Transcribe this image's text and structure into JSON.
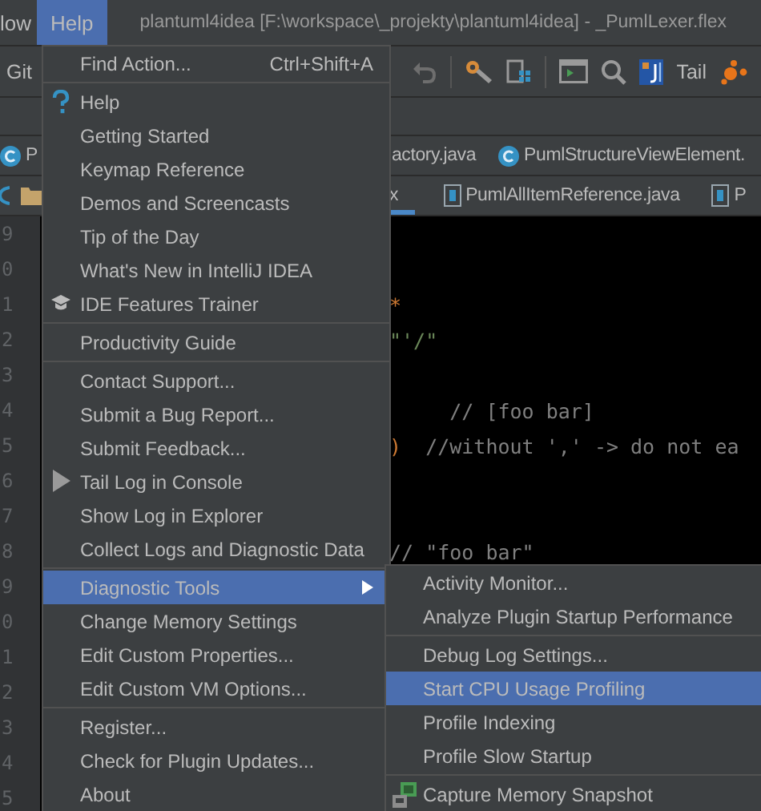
{
  "menu_bar": {
    "items": [
      {
        "label": "low",
        "selected": false
      },
      {
        "label": "Help",
        "selected": true
      }
    ],
    "title": "plantuml4idea [F:\\workspace\\_projekty\\plantuml4idea] - _PumlLexer.flex"
  },
  "toolbar": {
    "git_label": "Git",
    "tail_label": "Tail"
  },
  "tabs_row_1": [
    {
      "label": "P",
      "selected": false
    },
    {
      "label": "actory.java",
      "selected": false
    },
    {
      "label": "PumlStructureViewElement.",
      "selected": false
    }
  ],
  "tabs_row_2": [
    {
      "label": "x",
      "selected": true
    },
    {
      "label": "PumlAllItemReference.java",
      "selected": false
    },
    {
      "label": "P",
      "selected": false
    }
  ],
  "editor": {
    "lines": [
      {
        "number": "9"
      },
      {
        "number": "0"
      },
      {
        "number": "1",
        "code": [
          {
            "text": "*",
            "kind": "keyword"
          }
        ]
      },
      {
        "number": "2",
        "code": [
          {
            "text": "\"'/\"",
            "kind": "string"
          }
        ]
      },
      {
        "number": "3"
      },
      {
        "number": "4",
        "code": [
          {
            "text": "     // [foo bar]",
            "kind": "comment"
          }
        ]
      },
      {
        "number": "5",
        "code": [
          {
            "text": ")",
            "kind": "keyword"
          },
          {
            "text": "  //without ',' -> do not ea",
            "kind": "comment"
          }
        ]
      },
      {
        "number": "6"
      },
      {
        "number": "7"
      },
      {
        "number": "8",
        "code": [
          {
            "text": "// \"foo bar\"",
            "kind": "comment"
          }
        ]
      },
      {
        "number": "9"
      },
      {
        "number": "0"
      },
      {
        "number": "1"
      },
      {
        "number": "2"
      },
      {
        "number": "3"
      },
      {
        "number": "4"
      },
      {
        "number": "5"
      }
    ]
  },
  "help_menu": {
    "groups": [
      [
        {
          "label": "Find Action...",
          "shortcut": "Ctrl+Shift+A",
          "kind": "plain",
          "selected": false
        }
      ],
      [
        {
          "label": "Help",
          "kind": "help",
          "selected": false
        },
        {
          "label": "Getting Started",
          "kind": "plain",
          "selected": false
        },
        {
          "label": "Keymap Reference",
          "kind": "plain",
          "selected": false
        },
        {
          "label": "Demos and Screencasts",
          "kind": "plain",
          "selected": false
        },
        {
          "label": "Tip of the Day",
          "kind": "plain",
          "selected": false
        },
        {
          "label": "What's New in IntelliJ IDEA",
          "kind": "plain",
          "selected": false
        },
        {
          "label": "IDE Features Trainer",
          "kind": "trainer",
          "selected": false
        }
      ],
      [
        {
          "label": "Productivity Guide",
          "kind": "plain",
          "selected": false
        }
      ],
      [
        {
          "label": "Contact Support...",
          "kind": "plain",
          "selected": false
        },
        {
          "label": "Submit a Bug Report...",
          "kind": "plain",
          "selected": false
        },
        {
          "label": "Submit Feedback...",
          "kind": "plain",
          "selected": false
        },
        {
          "label": "Tail Log in Console",
          "kind": "console",
          "selected": false
        },
        {
          "label": "Show Log in Explorer",
          "kind": "plain",
          "selected": false
        },
        {
          "label": "Collect Logs and Diagnostic Data",
          "kind": "plain",
          "selected": false
        }
      ],
      [
        {
          "label": "Diagnostic Tools",
          "kind": "submenu",
          "selected": true
        },
        {
          "label": "Change Memory Settings",
          "kind": "plain",
          "selected": false
        },
        {
          "label": "Edit Custom Properties...",
          "kind": "plain",
          "selected": false
        },
        {
          "label": "Edit Custom VM Options...",
          "kind": "plain",
          "selected": false
        }
      ],
      [
        {
          "label": "Register...",
          "kind": "plain",
          "selected": false
        },
        {
          "label": "Check for Plugin Updates...",
          "kind": "plain",
          "selected": false
        },
        {
          "label": "About",
          "kind": "plain",
          "selected": false
        }
      ]
    ]
  },
  "diagnostic_submenu": {
    "groups": [
      [
        {
          "label": "Activity Monitor...",
          "kind": "plain",
          "selected": false
        },
        {
          "label": "Analyze Plugin Startup Performance",
          "kind": "plain",
          "selected": false
        }
      ],
      [
        {
          "label": "Debug Log Settings...",
          "kind": "plain",
          "selected": false
        },
        {
          "label": "Start CPU Usage Profiling",
          "kind": "plain",
          "selected": true
        },
        {
          "label": "Profile Indexing",
          "kind": "plain",
          "selected": false
        },
        {
          "label": "Profile Slow Startup",
          "kind": "plain",
          "selected": false
        }
      ],
      [
        {
          "label": "Capture Memory Snapshot",
          "kind": "snapshot",
          "selected": false
        }
      ]
    ]
  }
}
